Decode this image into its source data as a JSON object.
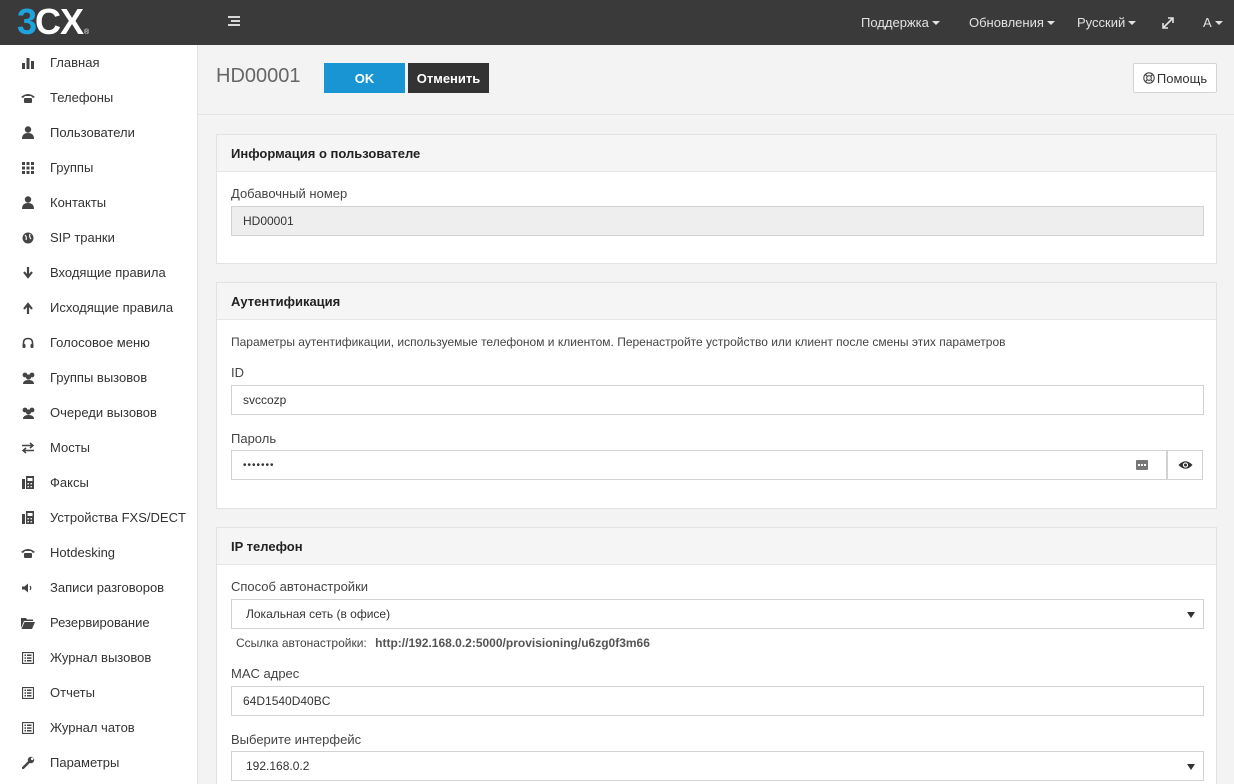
{
  "topbar": {
    "logo_3": "3",
    "logo_cx": "CX",
    "logo_reg": "®",
    "support": "Поддержка",
    "updates": "Обновления",
    "language": "Русский",
    "user": "A"
  },
  "sidebar": {
    "items": [
      {
        "label": "Главная",
        "icon": "bar-chart-icon"
      },
      {
        "label": "Телефоны",
        "icon": "phone-icon"
      },
      {
        "label": "Пользователи",
        "icon": "user-icon"
      },
      {
        "label": "Группы",
        "icon": "grid-icon"
      },
      {
        "label": "Контакты",
        "icon": "user-icon"
      },
      {
        "label": "SIP транки",
        "icon": "globe-icon"
      },
      {
        "label": "Входящие правила",
        "icon": "arrow-down-icon"
      },
      {
        "label": "Исходящие правила",
        "icon": "arrow-up-icon"
      },
      {
        "label": "Голосовое меню",
        "icon": "headset-icon"
      },
      {
        "label": "Группы вызовов",
        "icon": "users-icon"
      },
      {
        "label": "Очереди вызовов",
        "icon": "users-icon"
      },
      {
        "label": "Мосты",
        "icon": "transfer-icon"
      },
      {
        "label": "Факсы",
        "icon": "fax-icon"
      },
      {
        "label": "Устройства FXS/DECT",
        "icon": "fax-icon"
      },
      {
        "label": "Hotdesking",
        "icon": "phone-icon"
      },
      {
        "label": "Записи разговоров",
        "icon": "volume-icon"
      },
      {
        "label": "Резервирование",
        "icon": "folder-open-icon"
      },
      {
        "label": "Журнал вызовов",
        "icon": "list-icon"
      },
      {
        "label": "Отчеты",
        "icon": "list-icon"
      },
      {
        "label": "Журнал чатов",
        "icon": "list-icon"
      },
      {
        "label": "Параметры",
        "icon": "wrench-icon"
      }
    ]
  },
  "header": {
    "title": "HD00001",
    "ok_label": "OK",
    "cancel_label": "Отменить",
    "help_label": "Помощь"
  },
  "user_info": {
    "title": "Информация о пользователе",
    "ext_label": "Добавочный номер",
    "ext_value": "HD00001"
  },
  "auth": {
    "title": "Аутентификация",
    "description": "Параметры аутентификации, используемые телефоном и клиентом. Перенастройте устройство или клиент после смены этих параметров",
    "id_label": "ID",
    "id_value": "svccozp",
    "password_label": "Пароль",
    "password_value": "•••••••"
  },
  "ip_phone": {
    "title": "IP телефон",
    "provisioning_label": "Способ автонастройки",
    "provisioning_value": "Локальная сеть (в офисе)",
    "link_label": "Ссылка автонастройки:",
    "link_value": "http://192.168.0.2:5000/provisioning/u6zg0f3m66",
    "mac_label": "MAC адрес",
    "mac_value": "64D1540D40BC",
    "interface_label": "Выберите интерфейс",
    "interface_value": "192.168.0.2"
  }
}
